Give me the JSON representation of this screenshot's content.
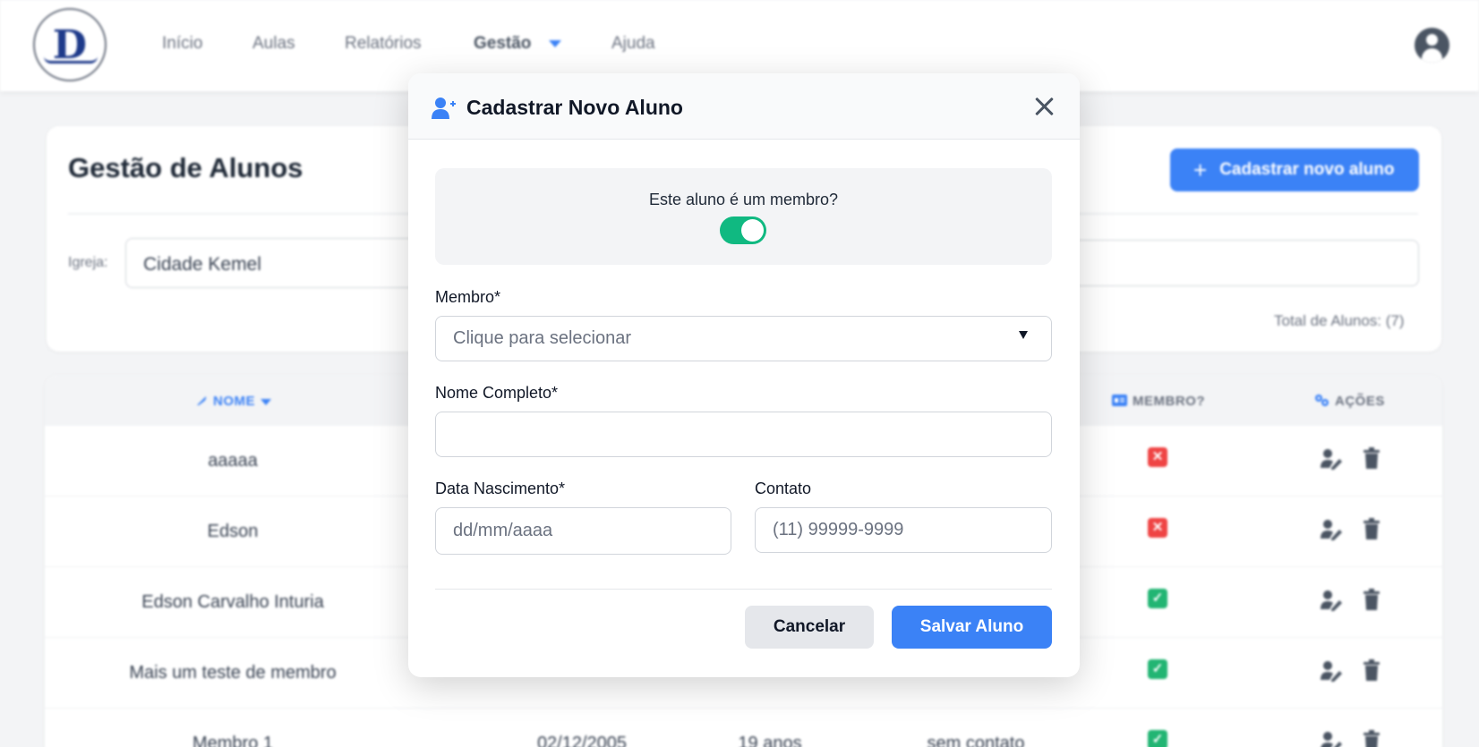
{
  "nav": {
    "items": [
      "Início",
      "Aulas",
      "Relatórios",
      "Gestão",
      "Ajuda"
    ],
    "active": "Gestão"
  },
  "page": {
    "title": "Gestão de Alunos",
    "new_button": "Cadastrar novo aluno",
    "church_label": "Igreja:",
    "church_value": "Cidade Kemel",
    "total": "Total de Alunos: (7)"
  },
  "table": {
    "headers": [
      "NOME",
      "MEMBRO?",
      "AÇÕES"
    ],
    "rows": [
      {
        "name": "aaaaa",
        "date": "",
        "age": "",
        "contact": "",
        "member": false
      },
      {
        "name": "Edson",
        "date": "",
        "age": "",
        "contact": "",
        "member": false
      },
      {
        "name": "Edson Carvalho Inturia",
        "date": "",
        "age": "",
        "contact": "",
        "member": true
      },
      {
        "name": "Mais um teste de membro",
        "date": "",
        "age": "",
        "contact": "",
        "member": true
      },
      {
        "name": "Membro 1",
        "date": "02/12/2005",
        "age": "19 anos",
        "contact": "sem contato",
        "member": true
      }
    ]
  },
  "modal": {
    "title": "Cadastrar Novo Aluno",
    "member_question": "Este aluno é um membro?",
    "member_toggle": true,
    "member_label": "Membro*",
    "member_placeholder": "Clique para selecionar",
    "fullname_label": "Nome Completo*",
    "fullname_value": "",
    "birth_label": "Data Nascimento*",
    "birth_placeholder": "dd/mm/aaaa",
    "contact_label": "Contato",
    "contact_placeholder": "(11) 99999-9999",
    "cancel": "Cancelar",
    "save": "Salvar Aluno"
  },
  "colors": {
    "primary": "#3b82f6",
    "success": "#22b573",
    "danger": "#ef4444",
    "toggle_on": "#10b981"
  },
  "icons": [
    "logo-icon",
    "chevron-down-icon",
    "user-avatar-icon",
    "plus-icon",
    "feather-icon",
    "id-card-icon",
    "gears-icon",
    "check-icon",
    "x-icon",
    "user-edit-icon",
    "trash-icon",
    "user-plus-icon",
    "close-icon"
  ]
}
